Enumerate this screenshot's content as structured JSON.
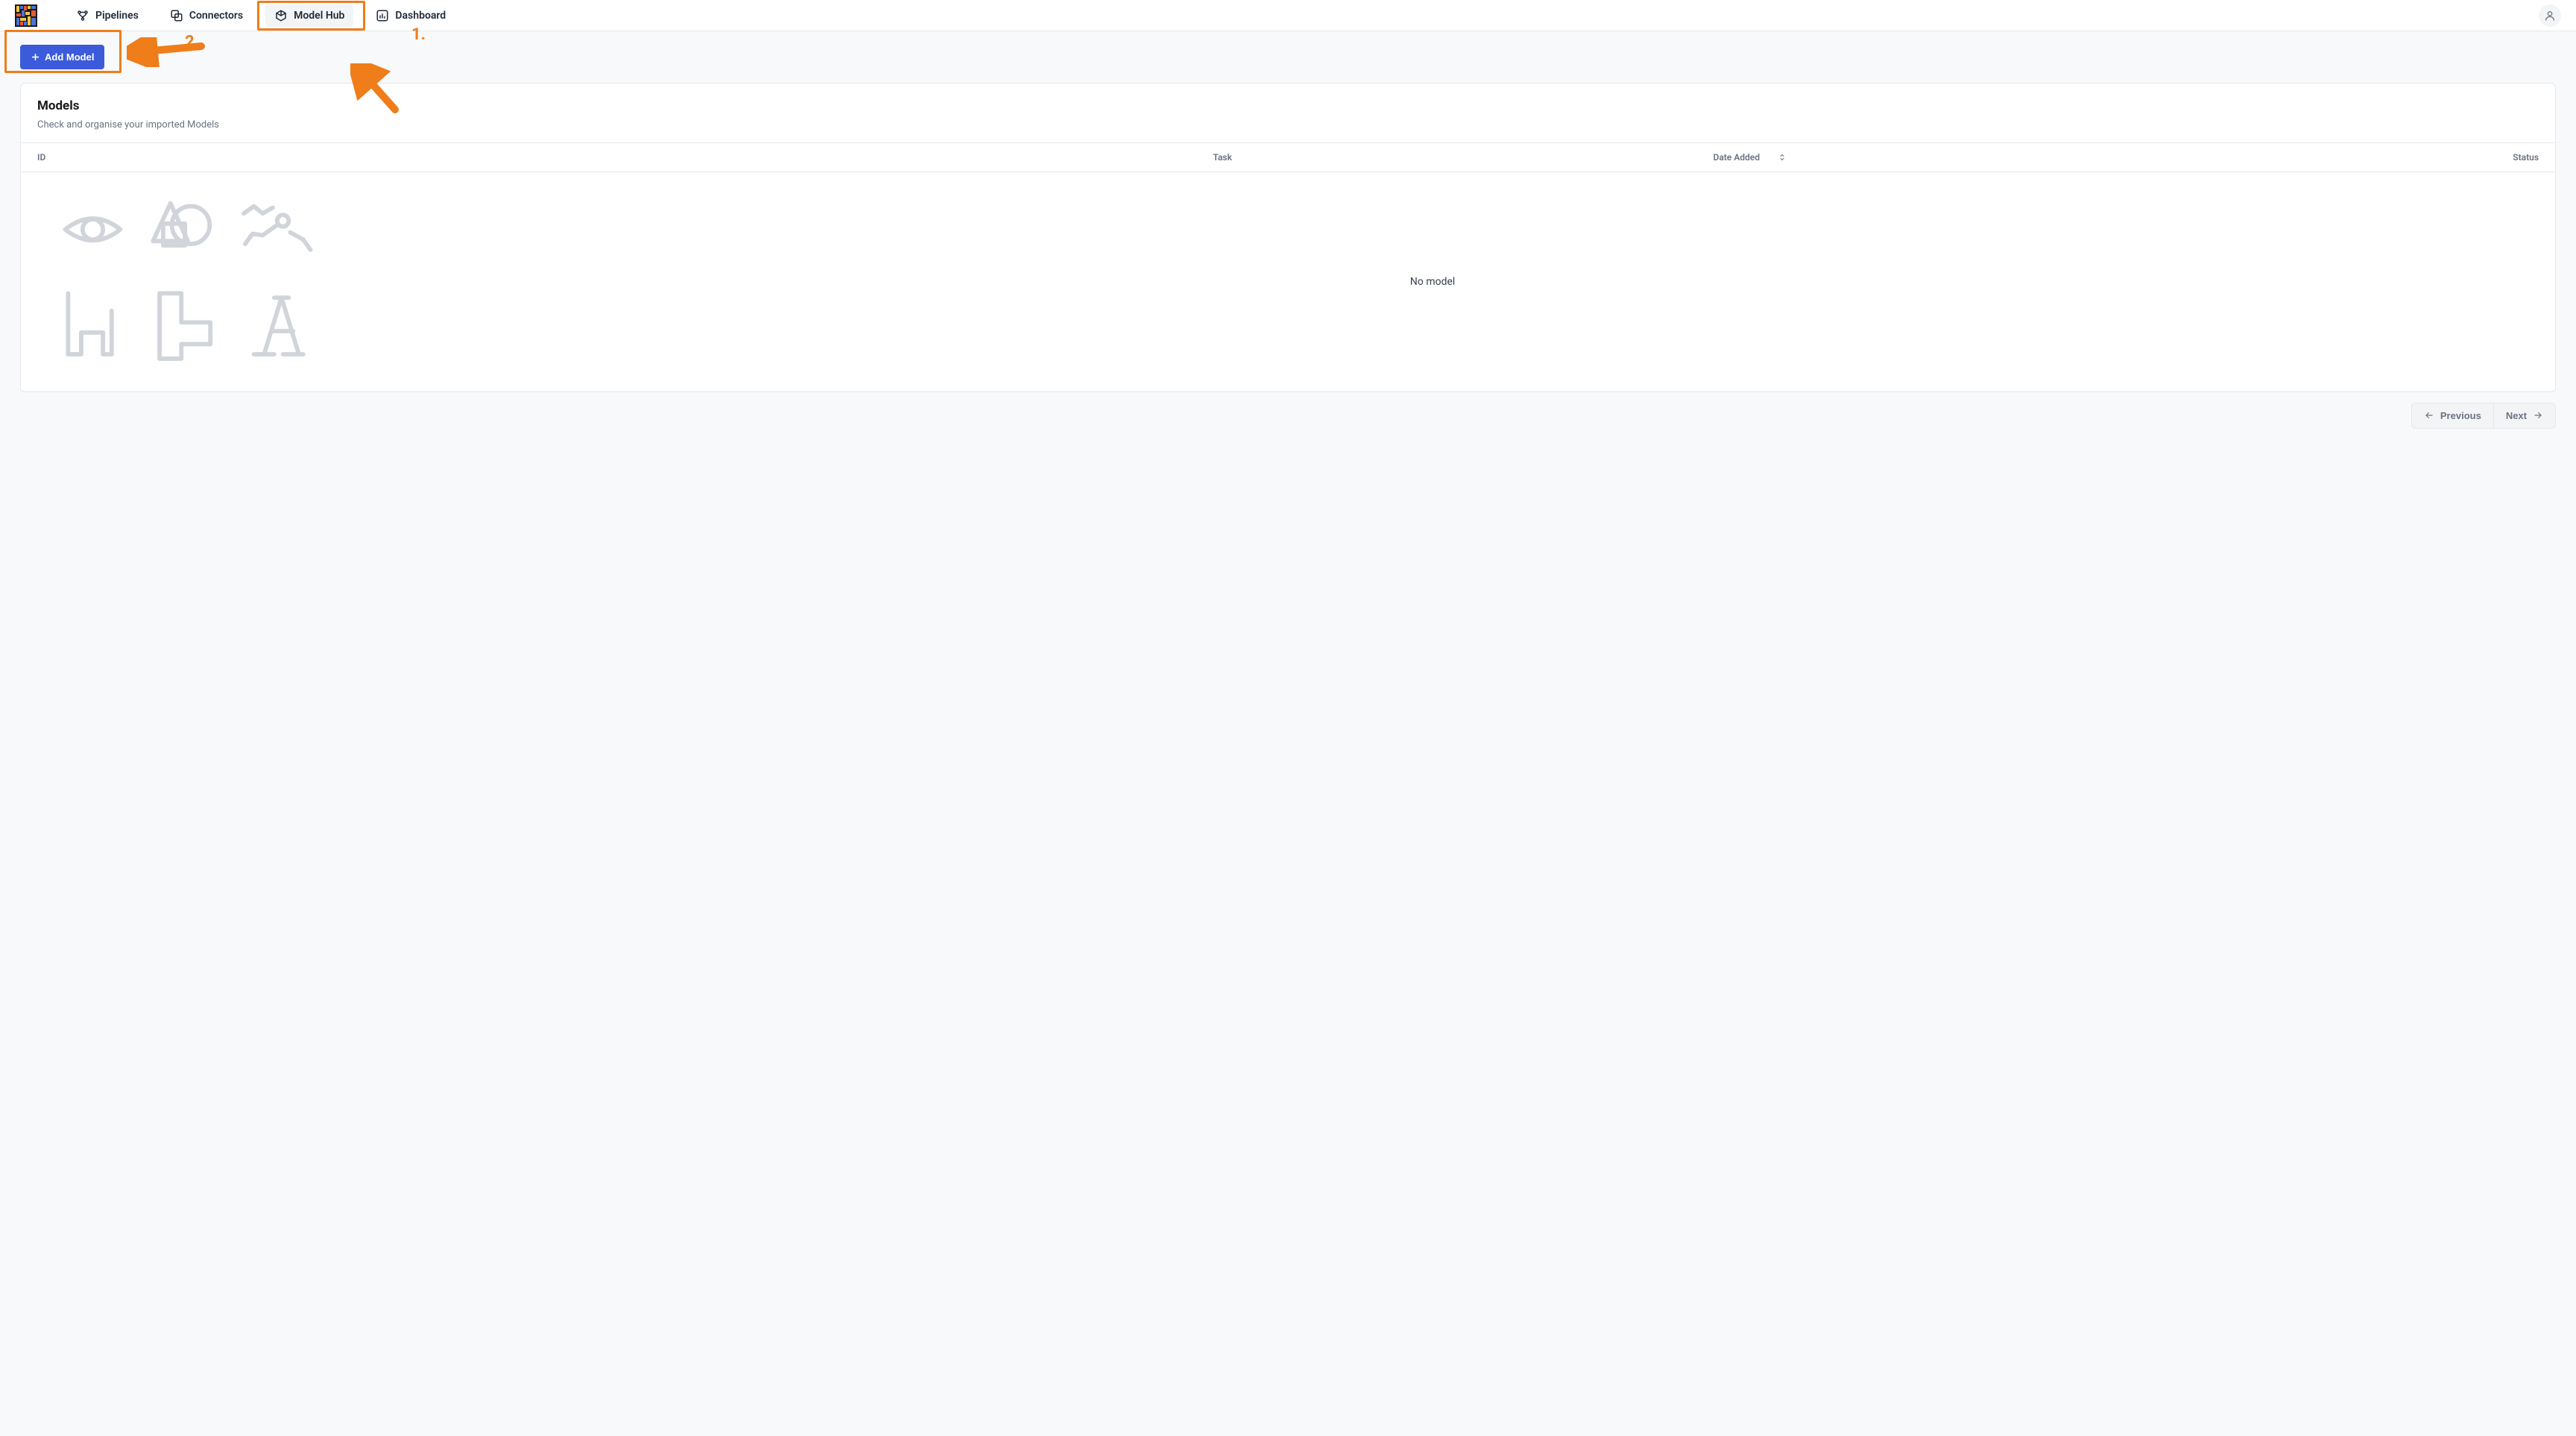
{
  "nav": {
    "items": [
      {
        "label": "Pipelines"
      },
      {
        "label": "Connectors"
      },
      {
        "label": "Model Hub"
      },
      {
        "label": "Dashboard"
      }
    ]
  },
  "actions": {
    "add_model": "Add Model"
  },
  "panel": {
    "title": "Models",
    "subtitle": "Check and organise your imported Models"
  },
  "columns": {
    "id": "ID",
    "task": "Task",
    "date_added": "Date Added",
    "status": "Status"
  },
  "empty_state": "No model",
  "pagination": {
    "previous": "Previous",
    "next": "Next"
  },
  "annotations": {
    "one": "1.",
    "two": "2."
  }
}
